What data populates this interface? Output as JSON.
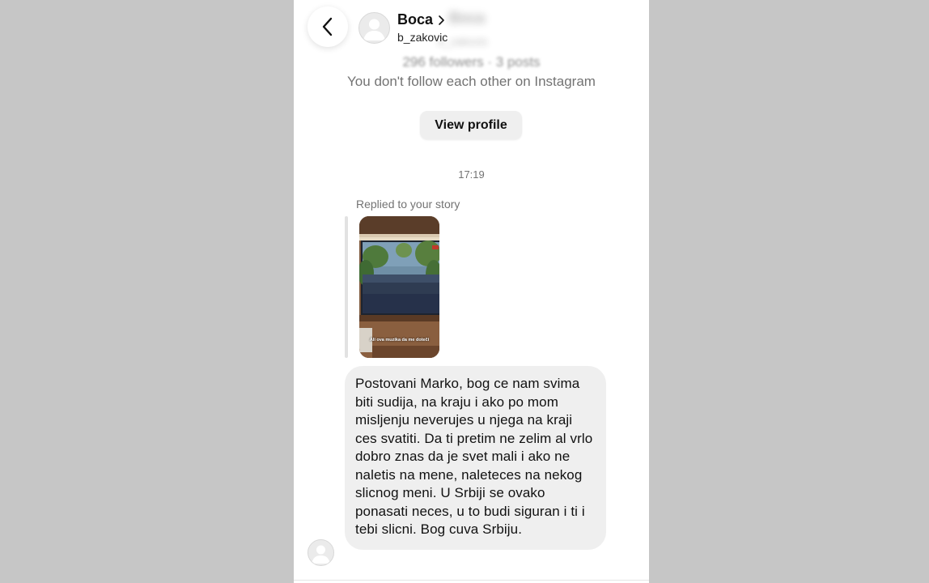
{
  "header": {
    "name": "Boca",
    "username": "b_zakovic",
    "blurred_name": "Boca",
    "blurred_username": "b_zakovic"
  },
  "profile": {
    "stats": "296 followers · 3 posts",
    "follow_note": "You don't follow each other on Instagram",
    "view_profile_label": "View profile"
  },
  "conversation": {
    "timestamp": "17:19",
    "replied_label": "Replied to your story",
    "story_caption": "Ali ova muzika da me doteči",
    "message": "Postovani Marko, bog ce nam svima biti sudija, na kraju i ako po mom misljenju neverujes u njega na kraji ces svatiti. Da ti pretim ne zelim al vrlo dobro znas da je svet mali i ako ne naletis na mene, naleteces na nekog slicnog meni. U Srbiji se ovako ponasati neces, u to budi siguran i ti i tebi slicni. Bog cuva Srbiju."
  },
  "colors": {
    "background": "#c6c6c6",
    "bubble": "#efefef",
    "secondary_text": "#737373"
  },
  "icons": {
    "back": "chevron-left-icon",
    "profile_chevron": "chevron-right-icon",
    "avatar": "default-avatar-icon"
  }
}
